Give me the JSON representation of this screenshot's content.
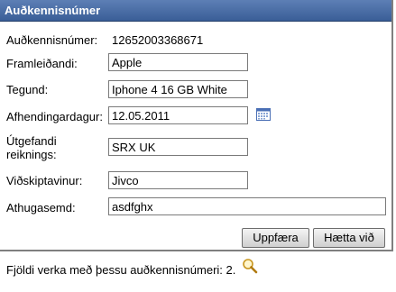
{
  "title": "Auðkennisnúmer",
  "fields": {
    "id_label": "Auðkennisnúmer:",
    "id_value": "12652003368671",
    "manufacturer_label": "Framleiðandi:",
    "manufacturer_value": "Apple",
    "type_label": "Tegund:",
    "type_value": "Iphone 4 16 GB White",
    "delivery_label": "Afhendingardagur:",
    "delivery_value": "12.05.2011",
    "invoice_issuer_label_line1": "Útgefandi",
    "invoice_issuer_label_line2": "reiknings:",
    "invoice_issuer_value": "SRX UK",
    "customer_label": "Viðskiptavinur:",
    "customer_value": "Jivco",
    "note_label": "Athugasemd:",
    "note_value": "asdfghx"
  },
  "buttons": {
    "update": "Uppfæra",
    "cancel": "Hætta við"
  },
  "footer": {
    "text": "Fjöldi verka með þessu auðkennisnúmeri: 2."
  },
  "icons": {
    "calendar": "calendar-icon",
    "search": "magnifier-icon"
  },
  "colors": {
    "titlebar": "#3a5e97",
    "calendar": "#4a6fb5"
  }
}
